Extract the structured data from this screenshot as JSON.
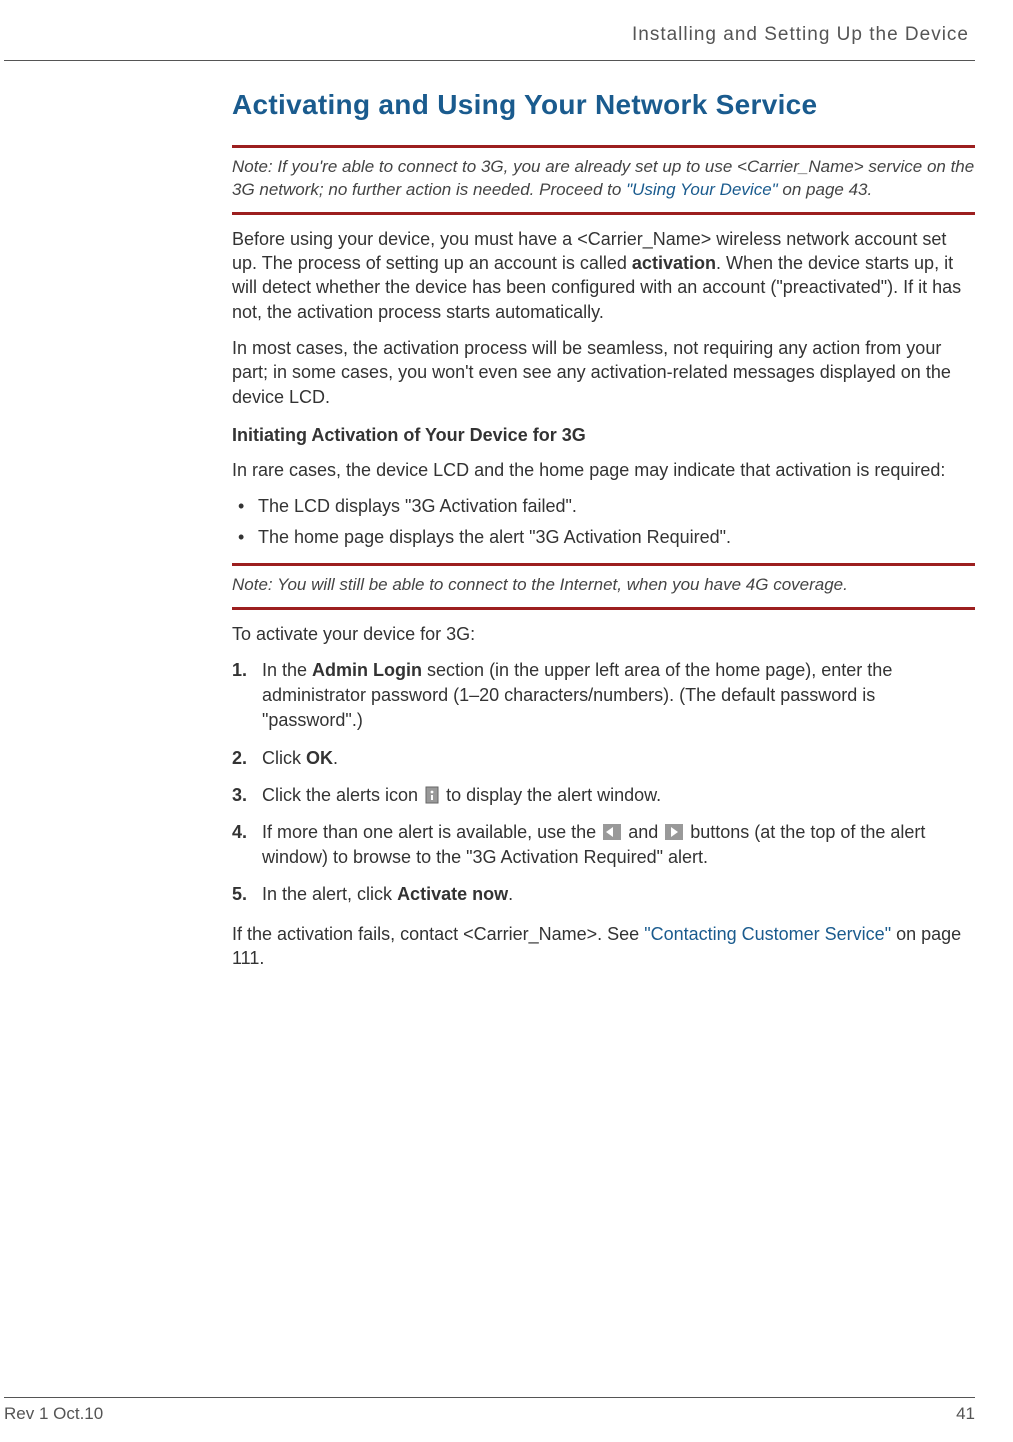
{
  "running_header": "Installing and Setting Up the Device",
  "title": "Activating and Using Your Network Service",
  "note1_prefix": "Note: ",
  "note1_part1": "If you're able to connect to 3G, you are already set up to use <Carrier_Name> service on the 3G network; no further action is needed. Proceed to ",
  "note1_link": "\"Using Your Device\"",
  "note1_part2": " on page 43.",
  "para1_a": "Before using your device, you must have a <Carrier_Name> wireless network account set up. The process of setting up an account is called ",
  "para1_bold": "activation",
  "para1_b": ". When the device starts up, it will detect whether the device has been configured with an account (\"preactivated\"). If it has not, the activation process starts automatically.",
  "para2": "In most cases, the activation process will be seamless, not requiring any action from your part; in some cases, you won't even see any activation-related messages displayed on the device LCD.",
  "subhead1": "Initiating Activation of Your Device for 3G",
  "para3": "In rare cases, the device LCD and the home page may indicate that activation is required:",
  "bullets": [
    "The LCD displays \"3G Activation failed\".",
    "The home page displays the alert \"3G Activation Required\"."
  ],
  "note2_prefix": "Note: ",
  "note2_text": "You will still be able to connect to the Internet, when you have 4G coverage.",
  "para4": "To activate your device for 3G:",
  "steps": {
    "s1_a": "In the ",
    "s1_bold": "Admin Login",
    "s1_b": " section (in the upper left area of the home page), enter the administrator password (1–20 characters/numbers). (The default password is \"password\".)",
    "s2_a": "Click ",
    "s2_bold": "OK",
    "s2_b": ".",
    "s3_a": "Click the alerts icon ",
    "s3_b": " to display the alert window.",
    "s4_a": "If more than one alert is available, use the ",
    "s4_mid": " and ",
    "s4_b": " buttons (at the top of the alert window) to browse to the \"3G Activation Required\" alert.",
    "s5_a": "In the alert, click ",
    "s5_bold": "Activate now",
    "s5_b": "."
  },
  "para5_a": "If the activation fails, contact <Carrier_Name>. See ",
  "para5_link": "\"Contacting Customer Service\"",
  "para5_b": " on page 111.",
  "footer_left": "Rev 1  Oct.10",
  "footer_right": "41"
}
